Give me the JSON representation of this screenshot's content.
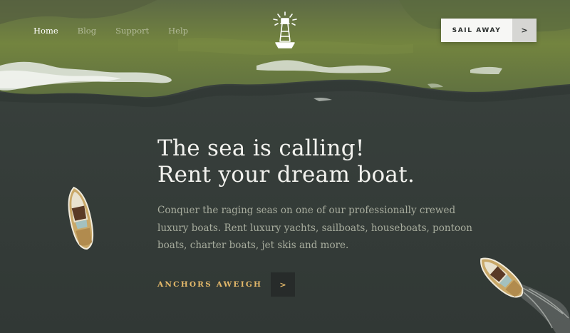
{
  "colors": {
    "sea": "#343b38",
    "shore": "#6f7f45",
    "accent": "#e3b86a",
    "heading": "#f2f2ee",
    "body_text": "#a8ad9e"
  },
  "nav": {
    "items": [
      {
        "label": "Home",
        "active": true
      },
      {
        "label": "Blog",
        "active": false
      },
      {
        "label": "Support",
        "active": false
      },
      {
        "label": "Help",
        "active": false
      }
    ]
  },
  "logo": {
    "icon": "lighthouse-icon"
  },
  "header_cta": {
    "label": "SAIL AWAY",
    "arrow": ">"
  },
  "hero": {
    "title_line1": "The sea is calling!",
    "title_line2": "Rent your dream boat.",
    "text": "Conquer the raging seas on one of our professionally crewed luxury boats. Rent luxury yachts, sailboats, houseboats, pontoon boats, charter boats, jet skis and more.",
    "cta_label": "ANCHORS AWEIGH",
    "cta_arrow": ">"
  }
}
